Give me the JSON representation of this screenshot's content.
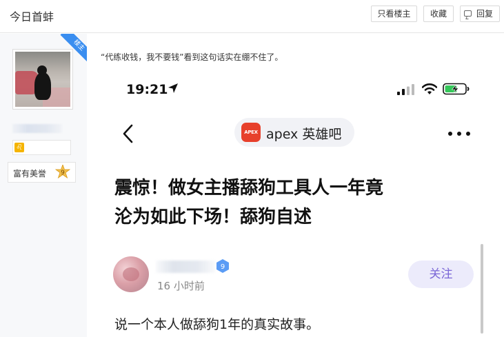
{
  "header": {
    "title": "今日首蚌",
    "buttons": {
      "only_op": "只看楼主",
      "favorite": "收藏",
      "reply": "回复"
    }
  },
  "user_panel": {
    "op_badge": "楼主",
    "honor_label": "富有美誉",
    "level": "9"
  },
  "post": {
    "quote_text": "“代练收钱，我不要钱”看到这句话实在绷不住了。"
  },
  "screenshot": {
    "status_time": "19:21",
    "forum_logo": "APEX",
    "forum_name": "apex 英雄吧",
    "title_line1": "震惊！做女主播舔狗工具人一年竟",
    "title_line2": "沦为如此下场！舔狗自述",
    "author_level": "9",
    "post_time": "16 小时前",
    "follow_label": "关注",
    "body_text": "说一个本人做舔狗1年的真实故事。",
    "colors": {
      "accent_purple": "#7a66d6",
      "follow_bg": "#ecebfb",
      "forum_logo_red": "#e7402b",
      "battery_green": "#34c759",
      "op_ribbon_blue": "#3a8ef0"
    }
  }
}
